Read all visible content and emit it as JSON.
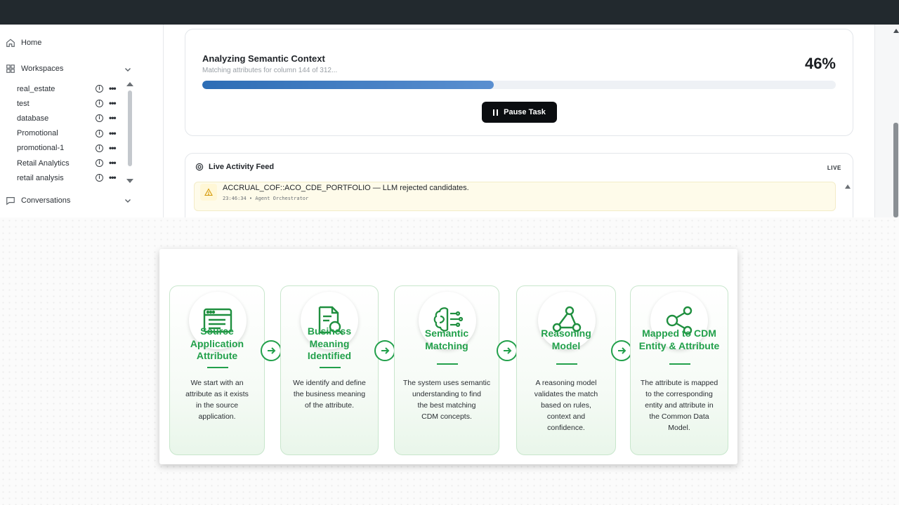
{
  "sidebar": {
    "home_label": "Home",
    "workspaces_label": "Workspaces",
    "workspaces": [
      {
        "label": "real_estate"
      },
      {
        "label": "test"
      },
      {
        "label": "database"
      },
      {
        "label": "Promotional"
      },
      {
        "label": "promotional-1"
      },
      {
        "label": "Retail Analytics"
      },
      {
        "label": "retail analysis"
      }
    ],
    "info_glyph": "i",
    "more_glyph": "•••",
    "conversations_label": "Conversations"
  },
  "task": {
    "title": "Analyzing Semantic Context",
    "subtitle": "Matching attributes for column 144 of 312...",
    "percent_label": "46%",
    "progress": 0.46,
    "pause_label": "Pause Task",
    "progress_color": "#2d6db5"
  },
  "feed": {
    "title": "Live Activity Feed",
    "badge": "LIVE",
    "items": [
      {
        "message": "ACCRUAL_COF::ACO_CDE_PORTFOLIO — LLM rejected candidates.",
        "meta": "23:46:34 • Agent Orchestrator",
        "icon": "warning-icon"
      }
    ]
  },
  "diagram": {
    "accent_color": "#22a04b",
    "steps": [
      {
        "icon": "browser-window-icon",
        "title_lines": [
          "Source",
          "Application",
          "Attribute"
        ],
        "desc_lines": [
          "We start with an",
          "attribute as it exists",
          "in the source",
          "application."
        ]
      },
      {
        "icon": "document-search-icon",
        "title_lines": [
          "Business",
          "Meaning",
          "Identified"
        ],
        "desc_lines": [
          "We identify and define",
          "the business meaning",
          "of the attribute."
        ]
      },
      {
        "icon": "brain-circuit-icon",
        "title_lines": [
          "Semantic",
          "Matching"
        ],
        "desc_lines": [
          "The system uses semantic",
          "understanding to find",
          "the best matching",
          "CDM concepts."
        ]
      },
      {
        "icon": "triangle-nodes-icon",
        "title_lines": [
          "Reasoning",
          "Model"
        ],
        "desc_lines": [
          "A reasoning model",
          "validates the match",
          "based on rules,",
          "context and",
          "confidence."
        ]
      },
      {
        "icon": "share-nodes-icon",
        "title_lines": [
          "Mapped to CDM",
          "Entity & Attribute"
        ],
        "desc_lines": [
          "The attribute is mapped",
          "to the corresponding",
          "entity and attribute in",
          "the Common Data",
          "Model."
        ]
      }
    ]
  }
}
